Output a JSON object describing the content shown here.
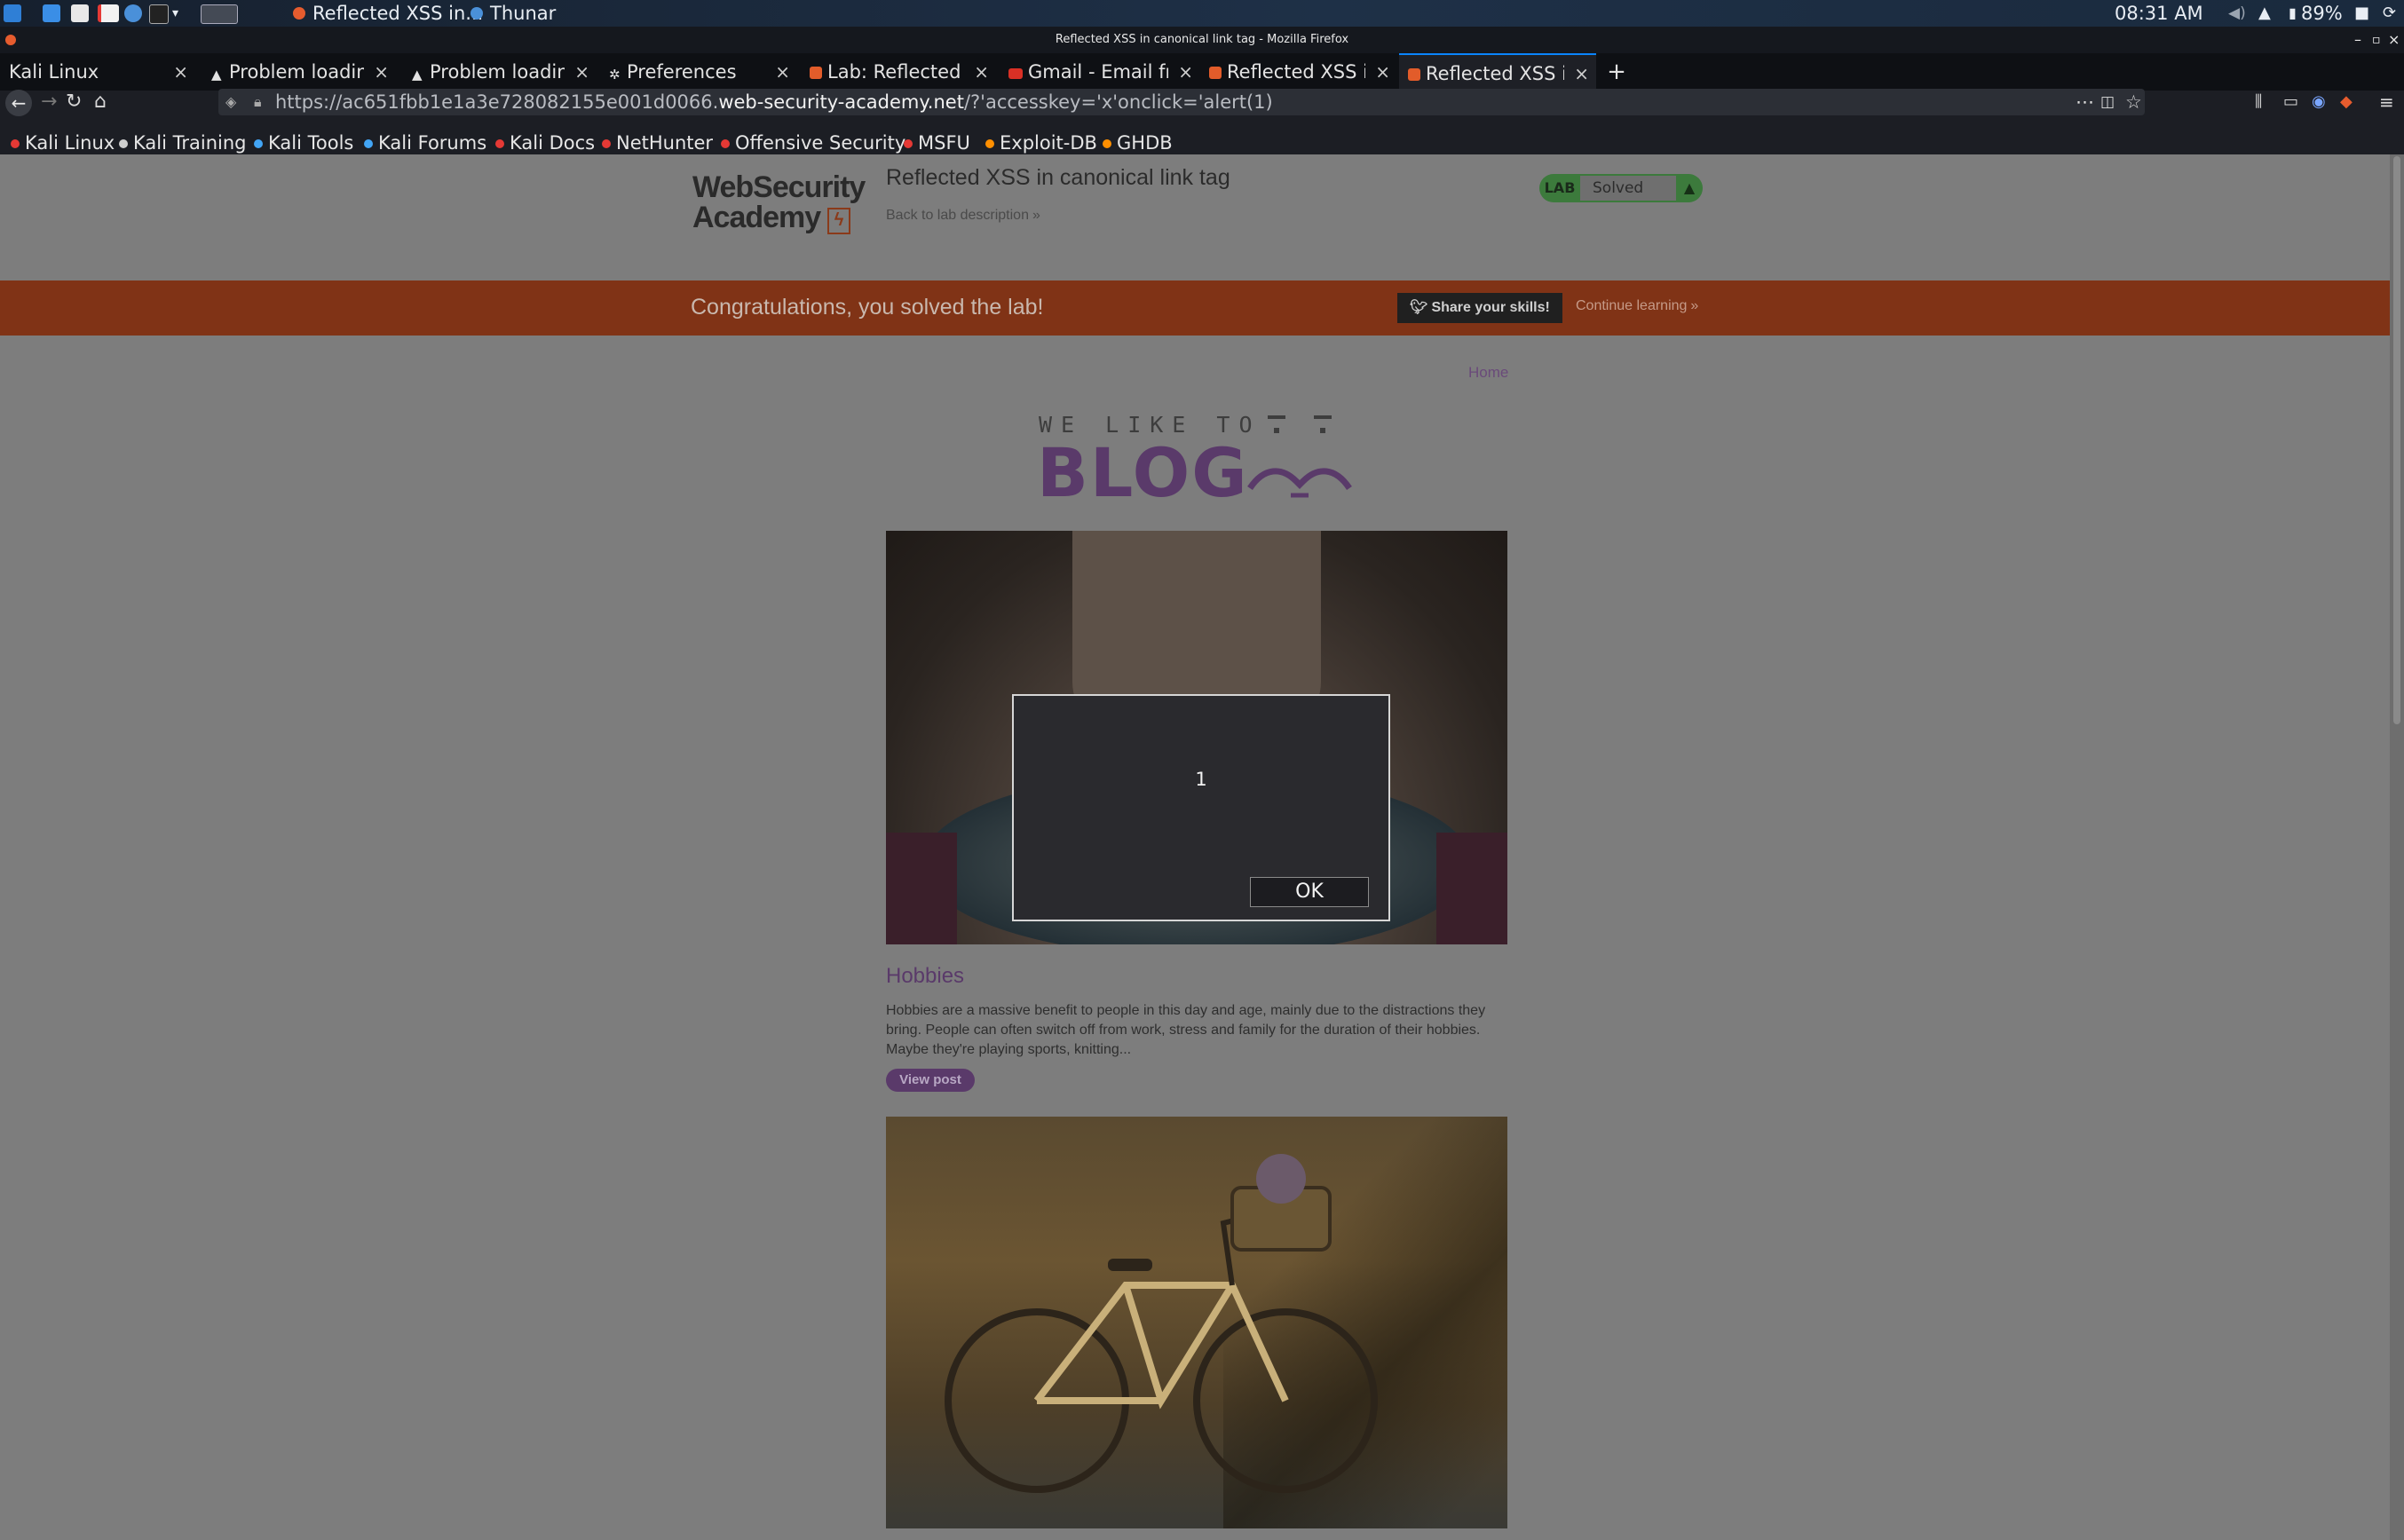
{
  "taskbar": {
    "window_firefox": "Reflected XSS in...",
    "window_thunar": "Thunar",
    "time": "08:31 AM",
    "battery": "89%"
  },
  "window_title": "Reflected XSS in canonical link tag - Mozilla Firefox",
  "tabs": [
    {
      "label": "Kali Linux"
    },
    {
      "label": "Problem loading"
    },
    {
      "label": "Problem loading"
    },
    {
      "label": "Preferences"
    },
    {
      "label": "Lab: Reflected XS"
    },
    {
      "label": "Gmail - Email fro"
    },
    {
      "label": "Reflected XSS in"
    },
    {
      "label": "Reflected XSS in"
    }
  ],
  "new_tab_label": "+",
  "url": {
    "prefix": "https://ac651fbb1e1a3e728082155e001d0066.",
    "domain": "web-security-academy.net",
    "suffix": "/?'accesskey='x'onclick='alert(1)"
  },
  "bookmarks": [
    {
      "label": "Kali Linux",
      "color": "#e53935"
    },
    {
      "label": "Kali Training",
      "color": "#cfcfcf"
    },
    {
      "label": "Kali Tools",
      "color": "#42a5f5"
    },
    {
      "label": "Kali Forums",
      "color": "#42a5f5"
    },
    {
      "label": "Kali Docs",
      "color": "#e53935"
    },
    {
      "label": "NetHunter",
      "color": "#e53935"
    },
    {
      "label": "Offensive Security",
      "color": "#e53935"
    },
    {
      "label": "MSFU",
      "color": "#e53935"
    },
    {
      "label": "Exploit-DB",
      "color": "#ff8f00"
    },
    {
      "label": "GHDB",
      "color": "#ff8f00"
    }
  ],
  "lab": {
    "logo_line1": "WebSecurity",
    "logo_line2": "Academy",
    "title": "Reflected XSS in canonical link tag",
    "back_link": "Back to lab description",
    "badge_label": "LAB",
    "status": "Solved"
  },
  "banner": {
    "message": "Congratulations, you solved the lab!",
    "share_label": "Share your skills!",
    "continue_label": "Continue learning"
  },
  "blog": {
    "home_link": "Home",
    "tagline_small": "WE LIKE TO",
    "tagline_big": "BLOG",
    "post1_title": "Hobbies",
    "post1_text": "Hobbies are a massive benefit to people in this day and age, mainly due to the distractions they bring. People can often switch off from work, stress and family for the duration of their hobbies. Maybe they're playing sports, knitting...",
    "view_post_label": "View post"
  },
  "dialog": {
    "message": "1",
    "ok_label": "OK"
  },
  "colors": {
    "banner": "#803316",
    "accent_purple": "#5a3a6a",
    "lab_green": "#3c7a3c",
    "tab_active_border": "#0a84ff"
  }
}
